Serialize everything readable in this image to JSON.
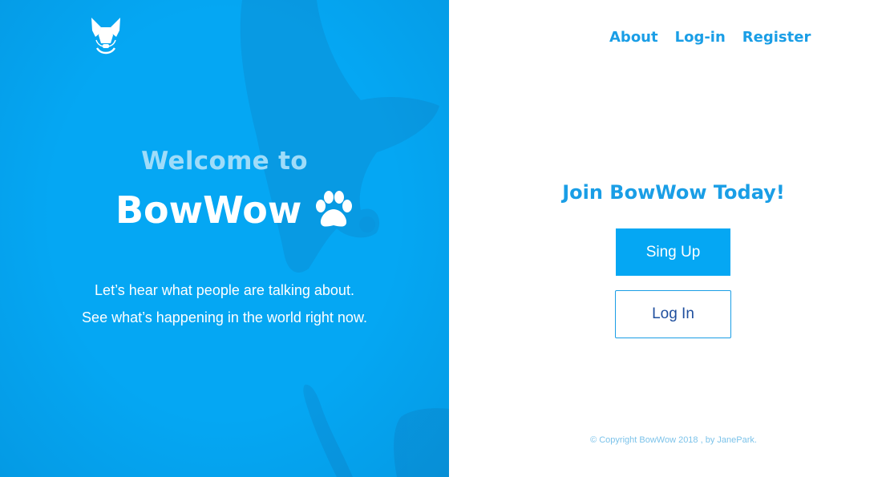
{
  "hero": {
    "welcome_text": "Welcome to",
    "brand_name": "BowWow",
    "tagline_1": "Let’s hear what people are talking about.",
    "tagline_2": "See what’s happening in the world right now.",
    "logo_icon": "dog-face-icon",
    "paw_icon": "paw-icon",
    "background_color": "#05a7f3"
  },
  "nav": {
    "items": [
      {
        "label": "About"
      },
      {
        "label": "Log-in"
      },
      {
        "label": "Register"
      }
    ]
  },
  "join": {
    "heading": "Join BowWow Today!",
    "signup_label": "Sing Up",
    "login_label": "Log In"
  },
  "footer": {
    "copyright": "© Copyright BowWow 2018 , by JanePark."
  },
  "colors": {
    "accent": "#1a9ee6",
    "button_fill": "#05a7f3",
    "login_text": "#1f4f9e"
  }
}
